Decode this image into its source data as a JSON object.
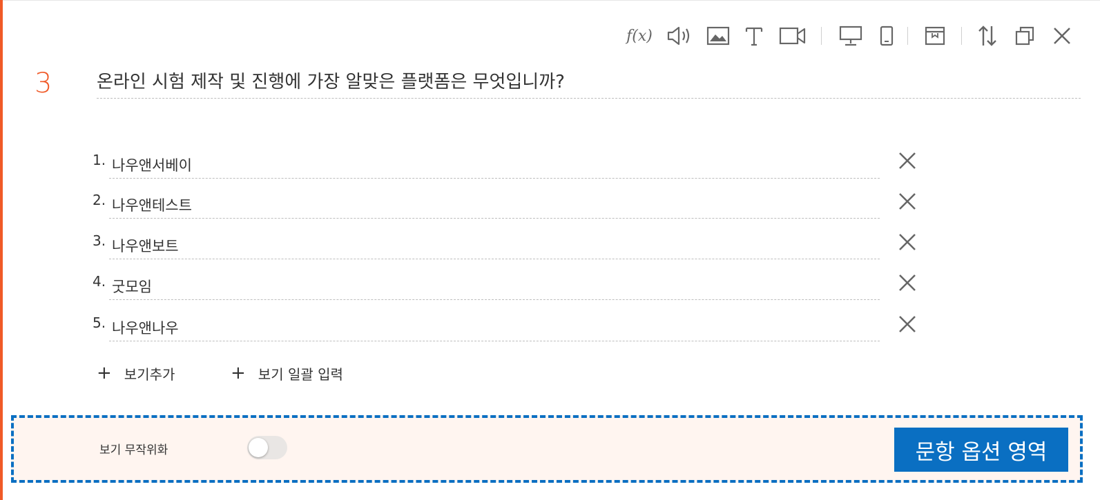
{
  "toolbar": {
    "formula_label": "f(x)",
    "icons": [
      "formula-icon",
      "audio-icon",
      "image-icon",
      "text-icon",
      "video-icon",
      "desktop-icon",
      "mobile-icon",
      "layout-icon",
      "sort-icon",
      "copy-icon",
      "close-icon"
    ]
  },
  "question": {
    "number": "3",
    "title": "온라인 시험 제작 및 진행에 가장 알맞은 플랫폼은 무엇입니까?"
  },
  "options": [
    {
      "num": "1.",
      "text": "나우앤서베이"
    },
    {
      "num": "2.",
      "text": "나우앤테스트"
    },
    {
      "num": "3.",
      "text": "나우앤보트"
    },
    {
      "num": "4.",
      "text": "굿모임"
    },
    {
      "num": "5.",
      "text": "나우앤나우"
    }
  ],
  "actions": {
    "add_plus": "+",
    "add_option": "보기추가",
    "bulk_plus": "+",
    "bulk_input": "보기 일괄 입력"
  },
  "option_area": {
    "shuffle_label": "보기 무작위화",
    "shuffle_on": false,
    "tag": "문항 옵션 영역"
  },
  "colors": {
    "accent": "#f05a28",
    "highlight_border": "#0a6fc2",
    "area_bg": "#fff5f0"
  }
}
